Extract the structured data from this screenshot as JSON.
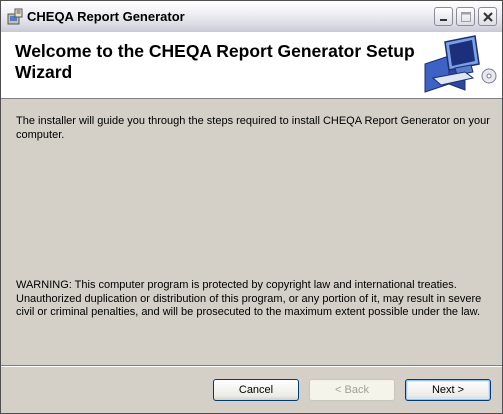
{
  "window": {
    "title": "CHEQA Report Generator",
    "icon": "installer-icon"
  },
  "titlebar_buttons": {
    "minimize": "minimize-icon",
    "maximize": "maximize-icon",
    "close": "close-icon"
  },
  "banner": {
    "title": "Welcome to the CHEQA Report Generator Setup Wizard",
    "art": "computer-setup-icon"
  },
  "body": {
    "intro": "The installer will guide you through the steps required to install CHEQA Report Generator on your computer.",
    "warning": "WARNING: This computer program is protected by copyright law and international treaties. Unauthorized duplication or distribution of this program, or any portion of it, may result in severe civil or criminal penalties, and will be prosecuted to the maximum extent possible under the law."
  },
  "buttons": {
    "cancel": "Cancel",
    "back": "< Back",
    "next": "Next >"
  },
  "colors": {
    "dialog_bg": "#d4d0c8",
    "default_button_focus": "#9bc4f2"
  }
}
